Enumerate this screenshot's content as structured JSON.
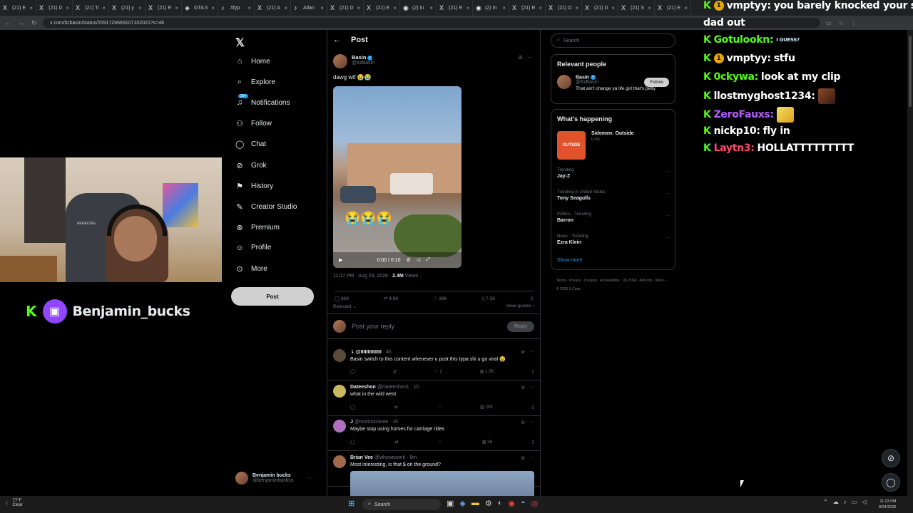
{
  "browser": {
    "tabs": [
      {
        "icon": "X",
        "label": "(21) E"
      },
      {
        "icon": "X",
        "label": "(21) D"
      },
      {
        "icon": "X",
        "label": "(21) Tı"
      },
      {
        "icon": "X",
        "label": "(21) y"
      },
      {
        "icon": "X",
        "label": "(21) R"
      },
      {
        "icon": "◈",
        "label": "GTA 6"
      },
      {
        "icon": "♪",
        "label": "#fyp"
      },
      {
        "icon": "X",
        "label": "(21) A"
      },
      {
        "icon": "♪",
        "label": "Atlan"
      },
      {
        "icon": "X",
        "label": "(21) D"
      },
      {
        "icon": "X",
        "label": "(21) E"
      },
      {
        "icon": "◉",
        "label": "(2) In"
      },
      {
        "icon": "X",
        "label": "(21) R"
      },
      {
        "icon": "◉",
        "label": "(2) In"
      },
      {
        "icon": "X",
        "label": "(21) R"
      },
      {
        "icon": "X",
        "label": "(21) D"
      },
      {
        "icon": "X",
        "label": "(21) D"
      },
      {
        "icon": "X",
        "label": "(21) S"
      },
      {
        "icon": "X",
        "label": "(21) E"
      }
    ],
    "url": "x.com/itzbasin/status/2091726669107102021?s=46"
  },
  "nav": {
    "items": [
      {
        "icon": "⌂",
        "label": "Home"
      },
      {
        "icon": "⌕",
        "label": "Explore"
      },
      {
        "icon": "♫",
        "label": "Notifications",
        "badge": "20+"
      },
      {
        "icon": "⚇",
        "label": "Follow"
      },
      {
        "icon": "◯",
        "label": "Chat"
      },
      {
        "icon": "⊘",
        "label": "Grok"
      },
      {
        "icon": "⚑",
        "label": "History"
      },
      {
        "icon": "✎",
        "label": "Creator Studio"
      },
      {
        "icon": "⊛",
        "label": "Premium"
      },
      {
        "icon": "☺",
        "label": "Profile"
      },
      {
        "icon": "⊙",
        "label": "More"
      }
    ],
    "post_button": "Post",
    "account": {
      "name": "Benjamin bucks",
      "handle": "@benjaminbuckss"
    }
  },
  "stream": {
    "channel": "Benjamin_bucks",
    "webcam_label": "AKRACING"
  },
  "post": {
    "header": "Post",
    "author": {
      "name": "Basin",
      "handle": "@ItzBasin"
    },
    "text": "dawg wtf 😭😭",
    "video": {
      "emojis": "😭😭😭",
      "time": "0:00 / 0:10"
    },
    "meta": {
      "time": "11:17 PM · Aug 23, 2026 ·",
      "views": "2.4M",
      "views_label": "Views"
    },
    "stats": {
      "replies": "808",
      "reposts": "4.9K",
      "likes": "39K",
      "bookmarks": "7.5K"
    },
    "sort": "Relevant",
    "view_quotes": "View quotes",
    "reply_placeholder": "Post your reply",
    "reply_button": "Reply"
  },
  "comments": [
    {
      "name": "⇂ @IIIIIIIIIIIIIII",
      "handle": "",
      "time": "· 4h",
      "text": "Basin switch to this content whenever u post this typa shi u go viral 😭",
      "likes": "1",
      "views": "1.7K",
      "color": "#5a4a3a"
    },
    {
      "name": "Dateeshon",
      "handle": "@Dateeshon1",
      "time": "· 1h",
      "text": "what in the wild west",
      "likes": "",
      "views": "203",
      "color": "#c8b860"
    },
    {
      "name": "J",
      "handle": "@hostnominee",
      "time": "· 1h",
      "text": "Maybe stop using horses for carriage rides",
      "likes": "",
      "views": "26",
      "color": "#b070c0"
    },
    {
      "name": "Brian Vee",
      "handle": "@whywework",
      "time": "· 8m",
      "text": "Most interesting, is that $ on the ground?",
      "likes": "",
      "views": "",
      "color": "#a06a4a"
    }
  ],
  "sidebar": {
    "search_placeholder": "Search",
    "relevant_title": "Relevant people",
    "relevant_person": {
      "name": "Basin",
      "handle": "@ItzBasin",
      "bio": "That ain't change ya life girl that's petty",
      "follow": "Follow"
    },
    "happening_title": "What's happening",
    "event": {
      "title": "Sidemen: Outside",
      "status": "LIVE",
      "thumb": "OUTSDE"
    },
    "trends": [
      {
        "context": "Trending",
        "topic": "Jay-Z"
      },
      {
        "context": "Trending in United States",
        "topic": "Tony Seagulls"
      },
      {
        "context": "Politics · Trending",
        "topic": "Barron"
      },
      {
        "context": "News · Trending",
        "topic": "Ezra Klein"
      }
    ],
    "show_more": "Show more",
    "footer": "Terms · Privacy · Cookies · Accessibility · US TIDA · Ads info · More··· © 2026 X Corp."
  },
  "chat": [
    {
      "user": "vmptyy:",
      "color": "#ffffff",
      "coin": "1",
      "text": "you barely knocked your step"
    },
    {
      "user": "",
      "color": "#ffffff",
      "coin": "",
      "text": "dad out"
    },
    {
      "user": "Gotulookn:",
      "color": "#53fc18",
      "coin": "",
      "text": "",
      "emote": "I GUESS?"
    },
    {
      "user": "vmptyy:",
      "color": "#ffffff",
      "coin": "1",
      "text": "stfu"
    },
    {
      "user": "0ckywa:",
      "color": "#53fc18",
      "coin": "",
      "text": "look at my clip"
    },
    {
      "user": "llostmyghost1234:",
      "color": "#ffffff",
      "coin": "",
      "text": "",
      "emote": "img"
    },
    {
      "user": "ZeroFauxs:",
      "color": "#b35cff",
      "coin": "",
      "text": "",
      "emote": "img2"
    },
    {
      "user": "nickp10:",
      "color": "#ffffff",
      "coin": "",
      "text": "fly in"
    },
    {
      "user": "Laytn3:",
      "color": "#ff4a6a",
      "coin": "",
      "text": "HOLLATTTTTTTTT"
    }
  ],
  "taskbar": {
    "weather": {
      "temp": "77°F",
      "desc": "Clear"
    },
    "search": "Search",
    "time": "11:23 PM",
    "date": "8/24/2026"
  }
}
